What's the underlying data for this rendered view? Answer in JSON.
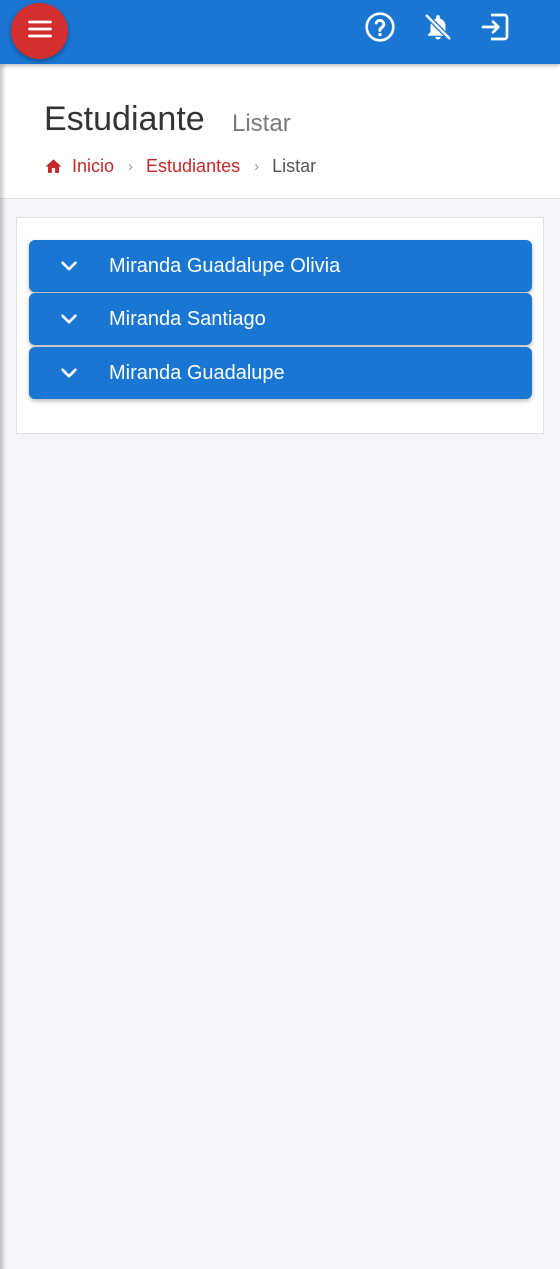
{
  "appbar": {
    "menu_icon": "menu-icon",
    "help_icon": "help-circle-icon",
    "notifications_icon": "bell-off-icon",
    "logout_icon": "logout-icon",
    "brand_color": "#1976d2",
    "menu_button_color": "#d32f2f"
  },
  "header": {
    "title": "Estudiante",
    "subtitle": "Listar"
  },
  "breadcrumb": {
    "home_icon": "home-icon",
    "items": [
      {
        "label": "Inicio"
      },
      {
        "label": "Estudiantes"
      },
      {
        "label": "Listar"
      }
    ],
    "separator": "›",
    "link_color": "#c62828"
  },
  "students": [
    {
      "name": "Miranda Guadalupe Olivia"
    },
    {
      "name": "Miranda Santiago"
    },
    {
      "name": "Miranda Guadalupe"
    }
  ],
  "accordion_icon": "chevron-down-icon"
}
